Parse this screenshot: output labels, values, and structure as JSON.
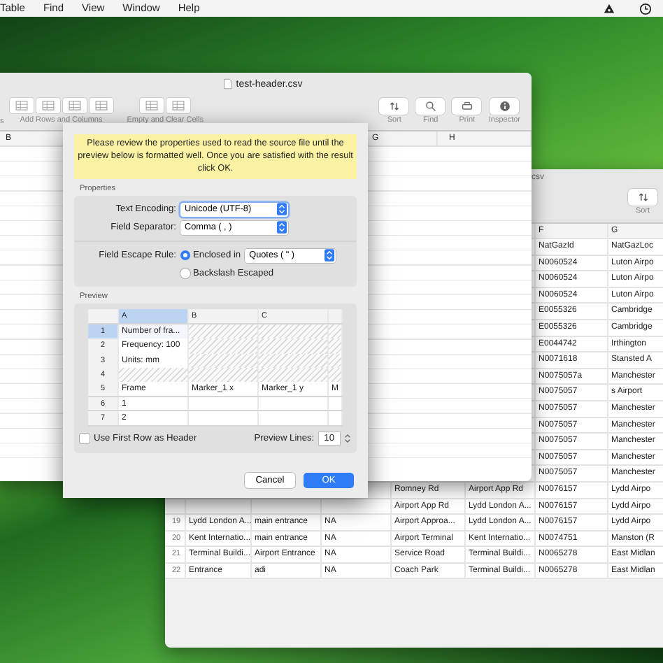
{
  "menu_bar": {
    "items": [
      "Table",
      "Find",
      "View",
      "Window",
      "Help"
    ]
  },
  "back_window": {
    "title": "csv",
    "toolbar": [
      {
        "label": "Sort"
      }
    ],
    "columns": [
      null,
      null,
      null,
      null,
      null,
      null,
      "F",
      "G"
    ],
    "rows": [
      {
        "cells": [
          null,
          null,
          null,
          null,
          null,
          null,
          "NatGazId",
          "NatGazLoc"
        ]
      },
      {
        "cells": [
          null,
          null,
          null,
          null,
          null,
          null,
          "N0060524",
          "Luton Airpo"
        ]
      },
      {
        "cells": [
          null,
          null,
          null,
          null,
          null,
          null,
          "N0060524",
          "Luton Airpo"
        ]
      },
      {
        "cells": [
          null,
          null,
          null,
          null,
          null,
          null,
          "N0060524",
          "Luton Airpo"
        ]
      },
      {
        "cells": [
          null,
          null,
          null,
          null,
          null,
          null,
          "E0055326",
          "Cambridge"
        ]
      },
      {
        "cells": [
          null,
          null,
          null,
          null,
          null,
          null,
          "E0055326",
          "Cambridge"
        ]
      },
      {
        "cells": [
          null,
          null,
          null,
          null,
          null,
          null,
          "E0044742",
          "Irthington"
        ]
      },
      {
        "cells": [
          null,
          null,
          null,
          null,
          null,
          null,
          "N0071618",
          "Stansted A"
        ]
      },
      {
        "cells": [
          null,
          null,
          null,
          null,
          null,
          null,
          "N0075057a",
          "Manchester"
        ]
      },
      {
        "cells": [
          null,
          null,
          null,
          null,
          null,
          null,
          "N0075057",
          "s Airport"
        ]
      },
      {
        "cells": [
          null,
          null,
          null,
          null,
          null,
          null,
          "N0075057",
          "Manchester"
        ]
      },
      {
        "cells": [
          null,
          null,
          null,
          null,
          null,
          null,
          "N0075057",
          "Manchester"
        ]
      },
      {
        "cells": [
          null,
          null,
          null,
          null,
          null,
          null,
          "N0075057",
          "Manchester"
        ]
      },
      {
        "cells": [
          null,
          null,
          null,
          null,
          null,
          null,
          "N0075057",
          "Manchester"
        ]
      },
      {
        "cells": [
          null,
          null,
          null,
          null,
          null,
          null,
          "N0075057",
          "Manchester"
        ]
      },
      {
        "cells": [
          null,
          null,
          null,
          null,
          "Romney Rd",
          "Airport App Rd",
          "N0076157",
          "Lydd Airpo"
        ]
      },
      {
        "cells": [
          null,
          null,
          null,
          null,
          "Airport App Rd",
          "Lydd London A...",
          "N0076157",
          "Lydd Airpo"
        ]
      },
      {
        "cells": [
          "19",
          "Lydd London A...",
          "main entrance",
          "NA",
          "Airport Approa...",
          "Lydd London A...",
          "N0076157",
          "Lydd Airpo"
        ]
      },
      {
        "cells": [
          "20",
          "Kent Internatio...",
          "main entrance",
          "NA",
          "Airport Terminal",
          "Kent Internatio...",
          "N0074751",
          "Manston (R"
        ]
      },
      {
        "cells": [
          "21",
          "Terminal Buildi...",
          "Airport Entrance",
          "NA",
          "Service Road",
          "Terminal Buildi...",
          "N0065278",
          "East Midlan"
        ]
      },
      {
        "cells": [
          "22",
          "Entrance",
          "adi",
          "NA",
          "Coach Park",
          "Terminal Buildi...",
          "N0065278",
          "East Midlan"
        ]
      }
    ]
  },
  "front_window": {
    "title": "test-header.csv",
    "toolbar_cut_label": "s",
    "toolbar_groups": [
      {
        "label": "Add Rows and Columns"
      },
      {
        "label": "Empty and Clear Cells"
      }
    ],
    "toolbar_items": [
      {
        "label": "Sort",
        "kind": "sort"
      },
      {
        "label": "Find",
        "kind": "find"
      },
      {
        "label": "Print",
        "kind": "print"
      },
      {
        "label": "Inspector",
        "kind": "info"
      }
    ],
    "columns": [
      "B",
      "G",
      "H"
    ]
  },
  "dialog": {
    "message": "Please review the properties used to read the source file until the preview below is formatted well. Once you are satisfied with the result click OK.",
    "properties": {
      "title": "Properties",
      "text_encoding": {
        "label": "Text Encoding:",
        "value": "Unicode (UTF-8)",
        "focused": true
      },
      "field_separator": {
        "label": "Field Separator:",
        "value": "Comma ( , )",
        "focused": false
      },
      "escape_rule": {
        "label": "Field Escape Rule:",
        "options": [
          {
            "label": "Enclosed in",
            "selected": true,
            "value": "Quotes ( \" )"
          },
          {
            "label": "Backslash Escaped",
            "selected": false
          }
        ]
      }
    },
    "preview": {
      "title": "Preview",
      "columns": [
        {
          "label": "A",
          "selected": true
        },
        {
          "label": "B",
          "selected": false
        },
        {
          "label": "C",
          "selected": false
        }
      ],
      "rows": [
        {
          "number": "1",
          "selected": true,
          "hatched": true,
          "cells": [
            "Number of fra..."
          ]
        },
        {
          "number": "2",
          "selected": false,
          "hatched": true,
          "cells": [
            "Frequency: 100"
          ]
        },
        {
          "number": "3",
          "selected": false,
          "hatched": true,
          "cells": [
            "Units: mm"
          ]
        },
        {
          "number": "4",
          "selected": false,
          "hatched": true,
          "cells": []
        },
        {
          "number": "5",
          "selected": false,
          "hatched": false,
          "cells": [
            "Frame",
            "Marker_1 x",
            "Marker_1 y",
            "M"
          ]
        },
        {
          "number": "6",
          "selected": false,
          "hatched": false,
          "cells": [
            "1"
          ]
        },
        {
          "number": "7",
          "selected": false,
          "hatched": false,
          "cells": [
            "2"
          ]
        }
      ],
      "use_first_row_as_header": {
        "label": "Use First Row as Header",
        "checked": false
      },
      "preview_lines": {
        "label": "Preview Lines:",
        "value": "10"
      }
    },
    "buttons": [
      {
        "label": "Cancel",
        "kind": "secondary"
      },
      {
        "label": "OK",
        "kind": "primary"
      }
    ]
  }
}
